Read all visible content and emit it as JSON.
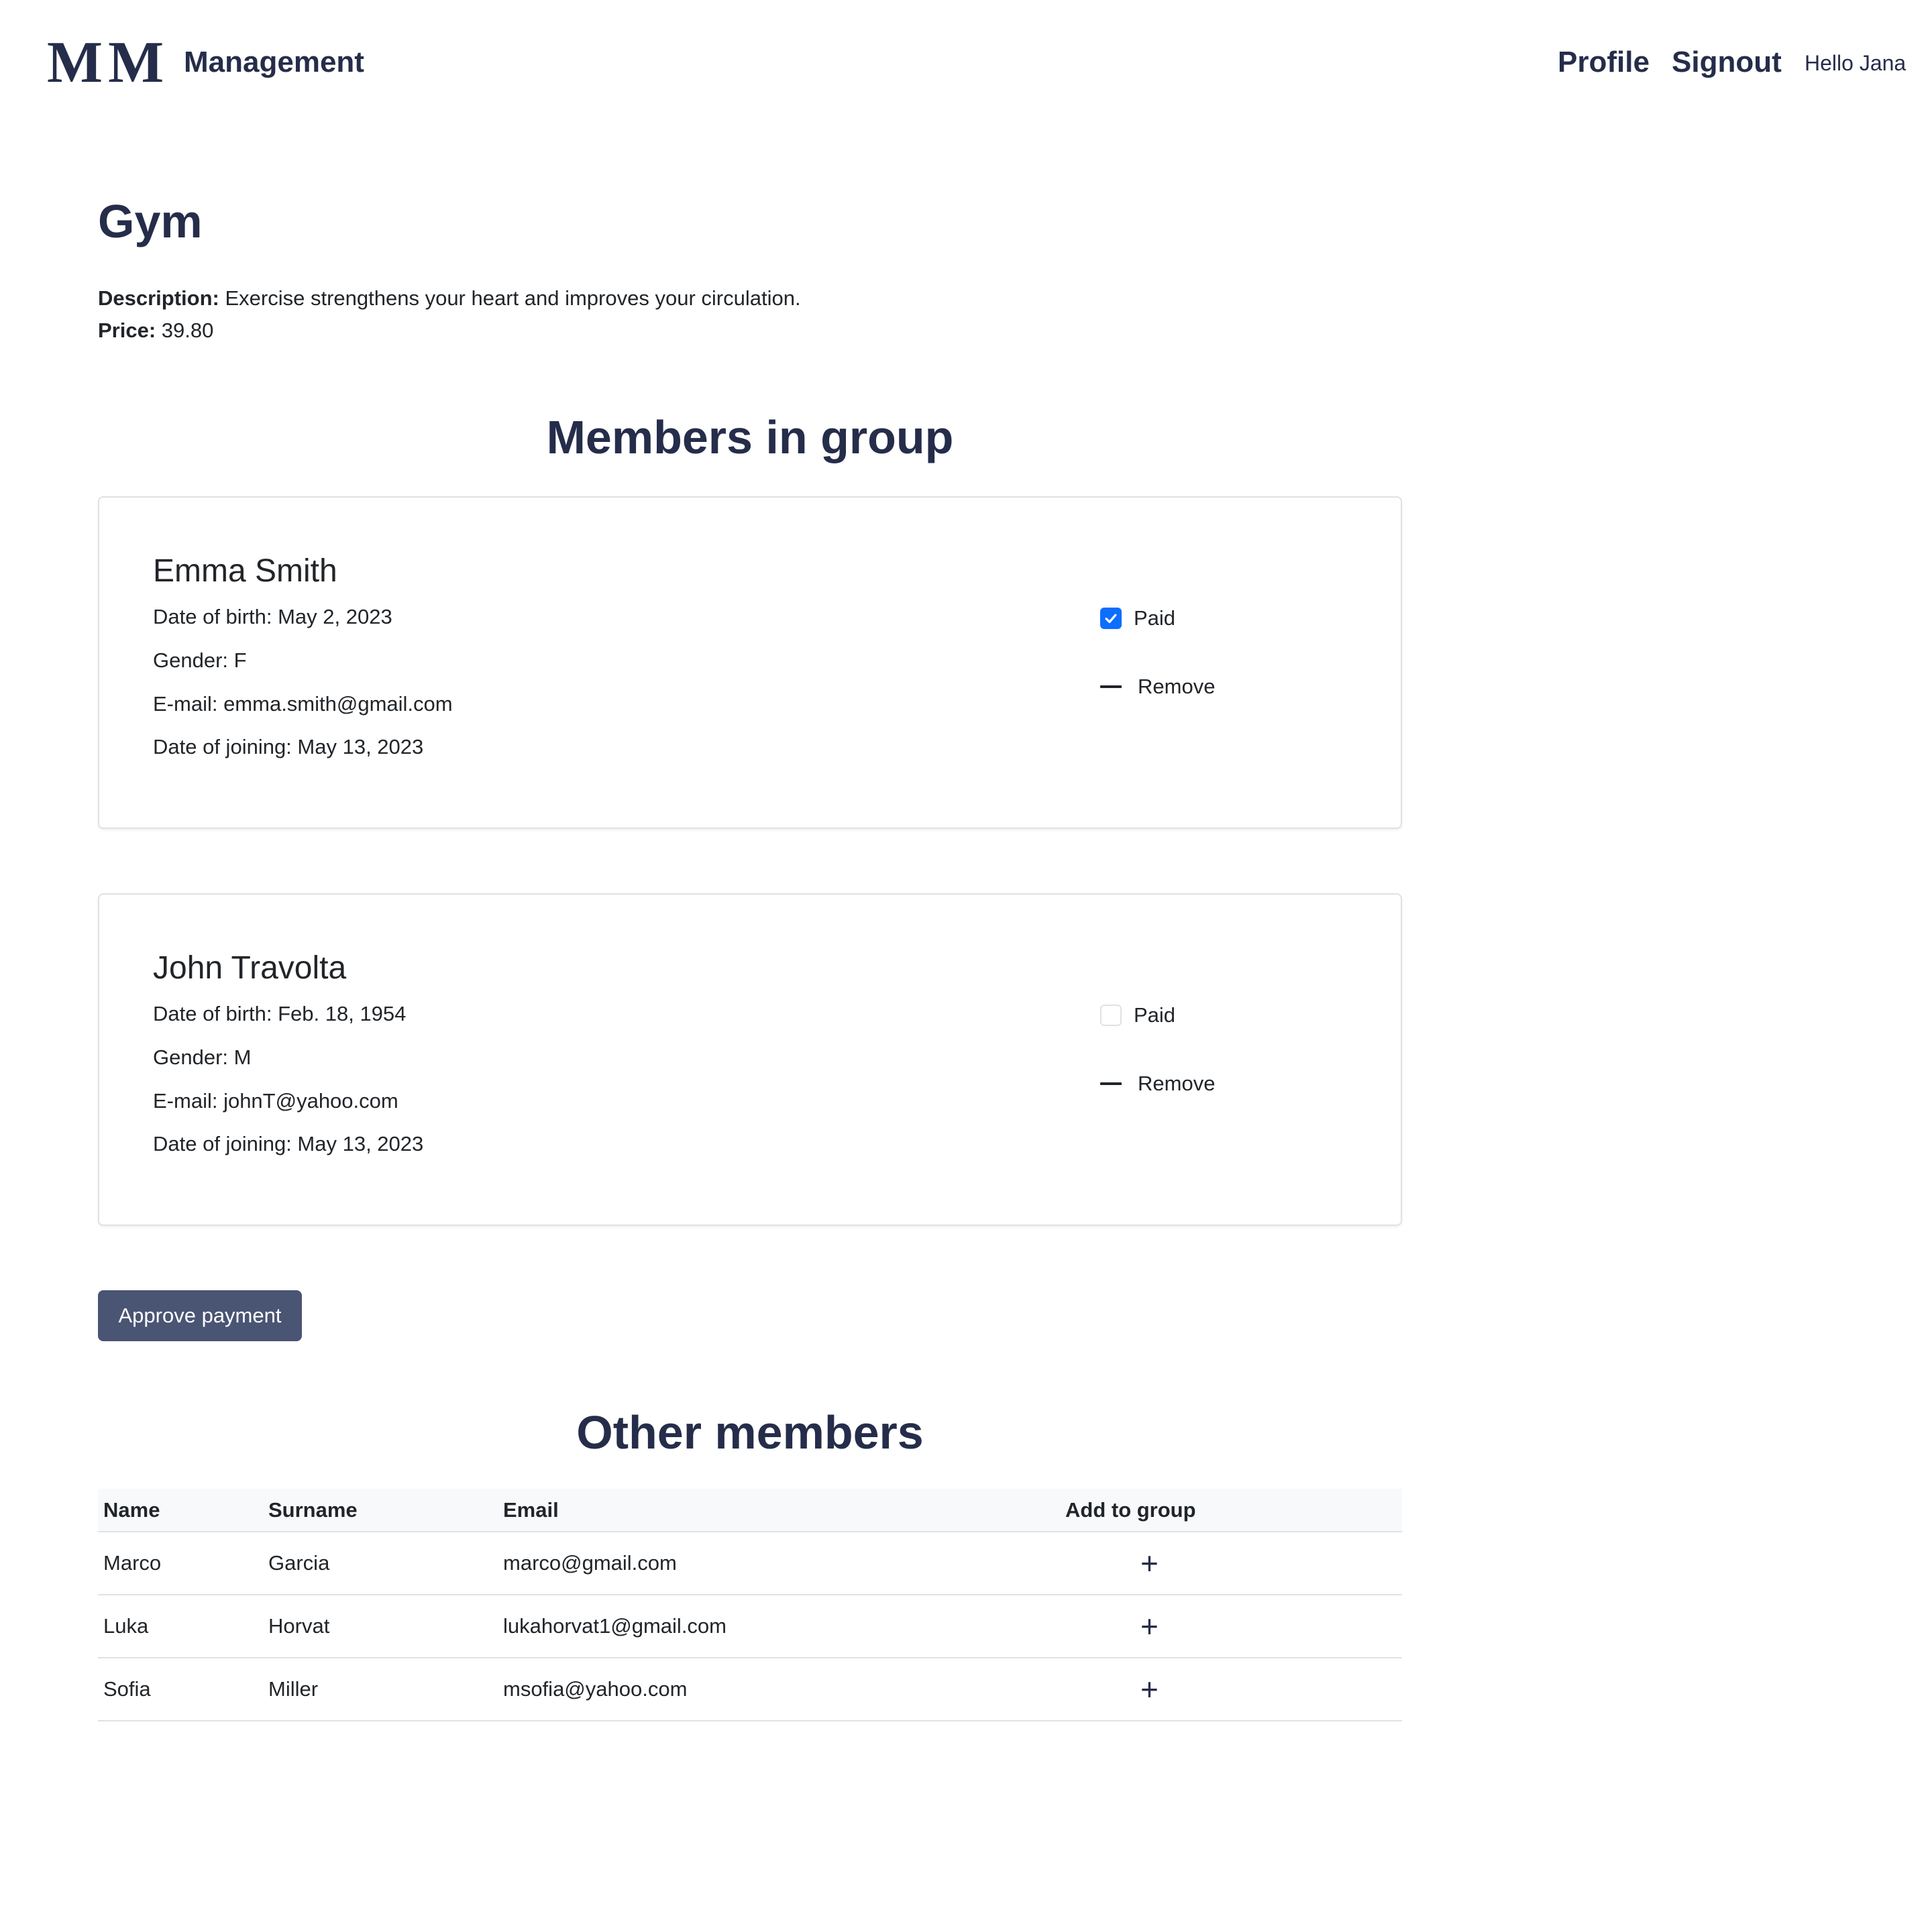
{
  "header": {
    "logo_text_left": "M",
    "logo_text_right": "M",
    "brand": "Management",
    "nav": {
      "profile": "Profile",
      "signout": "Signout"
    },
    "greeting": "Hello Jana"
  },
  "group": {
    "title": "Gym",
    "description_label": "Description:",
    "description": "Exercise strengthens your heart and improves your circulation.",
    "price_label": "Price:",
    "price": "39.80"
  },
  "members_section": {
    "title": "Members in group",
    "paid_label": "Paid",
    "remove_label": "Remove",
    "members": [
      {
        "name": "Emma Smith",
        "dob": "Date of birth: May 2, 2023",
        "gender": "Gender: F",
        "email": "E-mail: emma.smith@gmail.com",
        "joined": "Date of joining: May 13, 2023",
        "paid": true
      },
      {
        "name": "John Travolta",
        "dob": "Date of birth: Feb. 18, 1954",
        "gender": "Gender: M",
        "email": "E-mail: johnT@yahoo.com",
        "joined": "Date of joining: May 13, 2023",
        "paid": false
      }
    ]
  },
  "approve_button": "Approve payment",
  "others_section": {
    "title": "Other members",
    "columns": [
      "Name",
      "Surname",
      "Email",
      "Add to group"
    ],
    "rows": [
      {
        "name": "Marco",
        "surname": "Garcia",
        "email": "marco@gmail.com"
      },
      {
        "name": "Luka",
        "surname": "Horvat",
        "email": "lukahorvat1@gmail.com"
      },
      {
        "name": "Sofia",
        "surname": "Miller",
        "email": "msofia@yahoo.com"
      }
    ],
    "add_symbol": "+"
  },
  "colors": {
    "primary_text": "#252d4a",
    "button_bg": "#4a5473",
    "checkbox_checked": "#0d6efd",
    "border": "#dee2e6"
  },
  "icons": {
    "check": "check-icon",
    "remove": "minus-icon",
    "add": "plus-icon"
  }
}
